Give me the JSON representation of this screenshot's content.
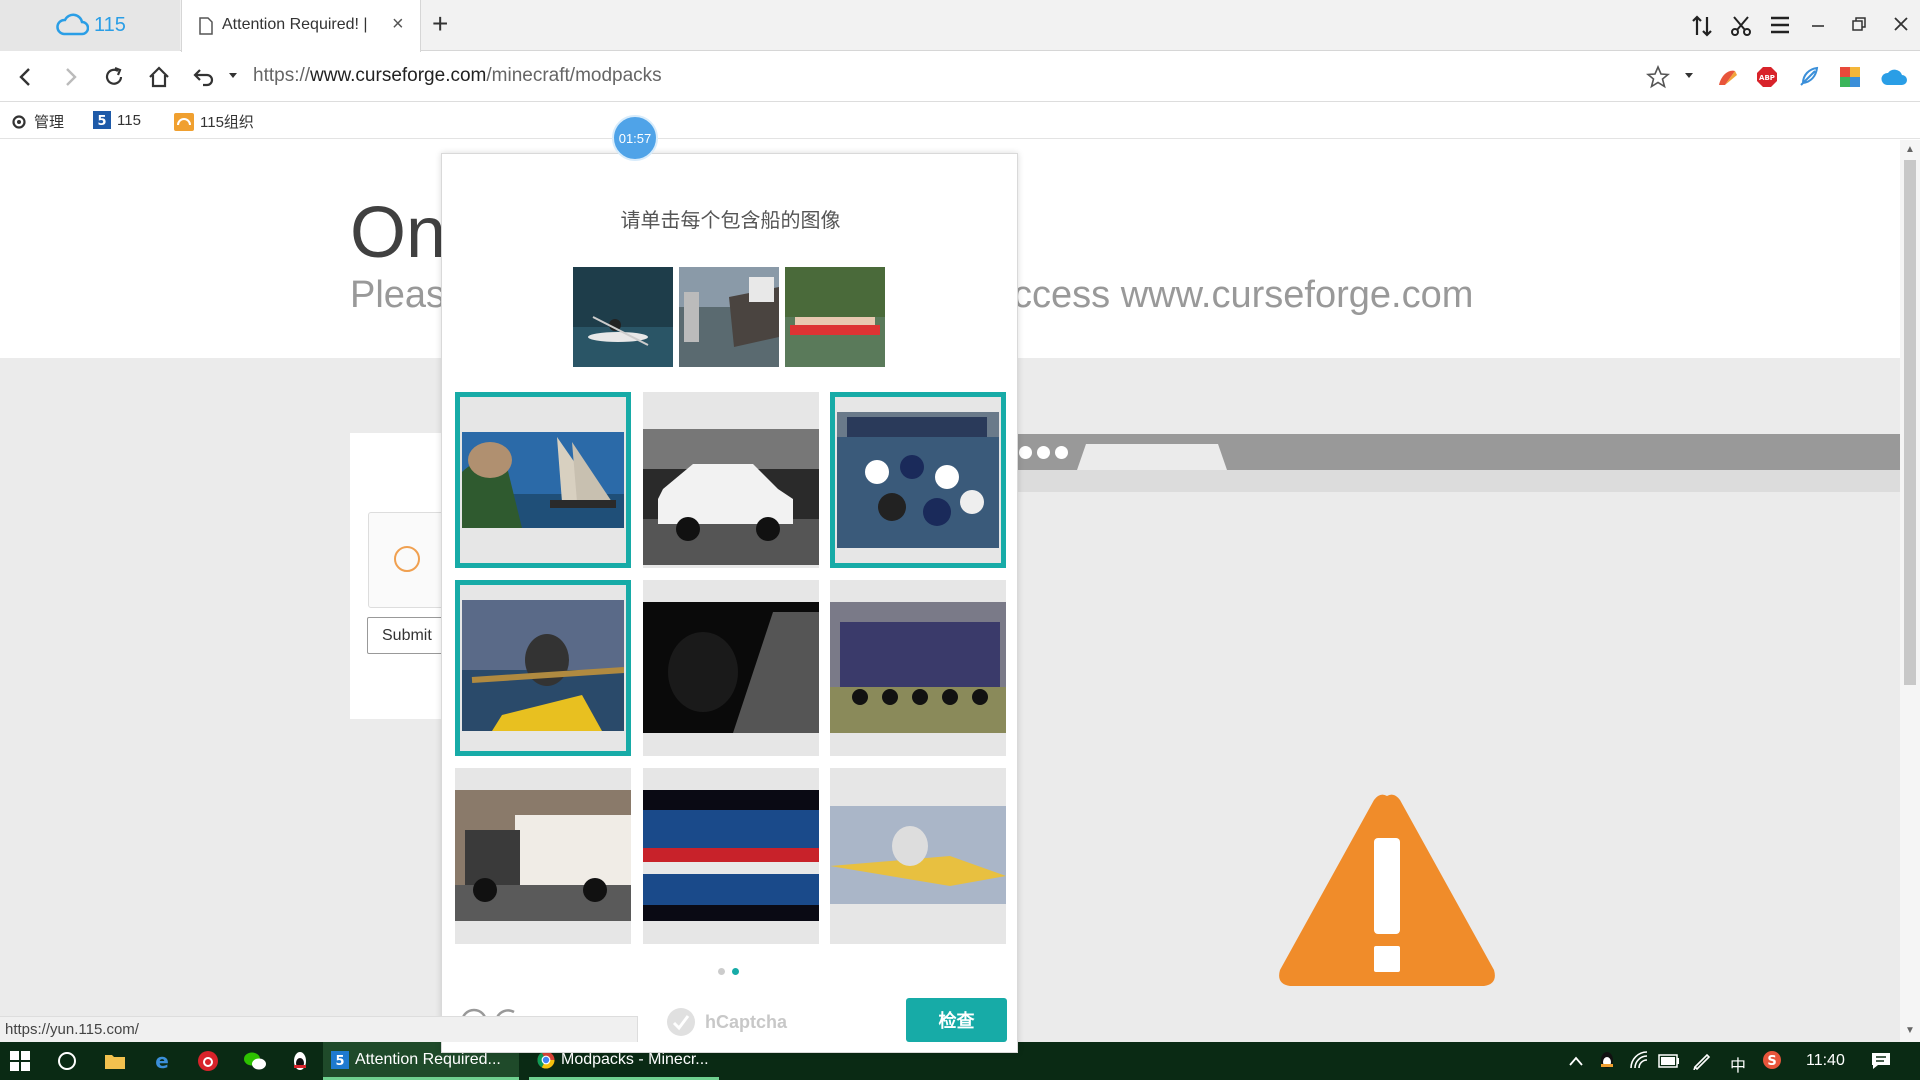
{
  "browser": {
    "home_tab_label": "115",
    "active_tab_title": "Attention Required! | C",
    "url_prefix": "https://",
    "url_domain": "www.curseforge.com",
    "url_path": "/minecraft/modpacks",
    "bookmarks": [
      "管理",
      "115",
      "115组织"
    ],
    "status_url": "https://yun.115.com/"
  },
  "page": {
    "heading": "On",
    "subtitle_left": "Pleas",
    "subtitle_right": "ccess www.curseforge.com",
    "submit_label": "Submit"
  },
  "captcha": {
    "timer": "01:57",
    "prompt": "请单击每个包含船的图像",
    "examples": [
      "kayak-example",
      "harbor-boat-example",
      "dragon-boat-example"
    ],
    "cells": [
      {
        "name": "sailboat",
        "selected": true
      },
      {
        "name": "white-car",
        "selected": false
      },
      {
        "name": "dragon-boat-crew",
        "selected": true
      },
      {
        "name": "kayaker",
        "selected": true
      },
      {
        "name": "motorcycle-road",
        "selected": false
      },
      {
        "name": "heavy-truck",
        "selected": false
      },
      {
        "name": "semi-truck",
        "selected": false
      },
      {
        "name": "dragon-boat-race",
        "selected": false
      },
      {
        "name": "yellow-kayak",
        "selected": false
      }
    ],
    "page_dots": 2,
    "current_page": 2,
    "logo_text": "hCaptcha",
    "check_label": "检查"
  },
  "taskbar": {
    "tasks": [
      "Attention Required...",
      "Modpacks - Minecr..."
    ],
    "ime": "中",
    "time": "11:40"
  },
  "colors": {
    "accent": "#17aba7",
    "warning": "#f08c2a",
    "timer": "#4fa3e8",
    "taskbar": "#0a2a14"
  }
}
